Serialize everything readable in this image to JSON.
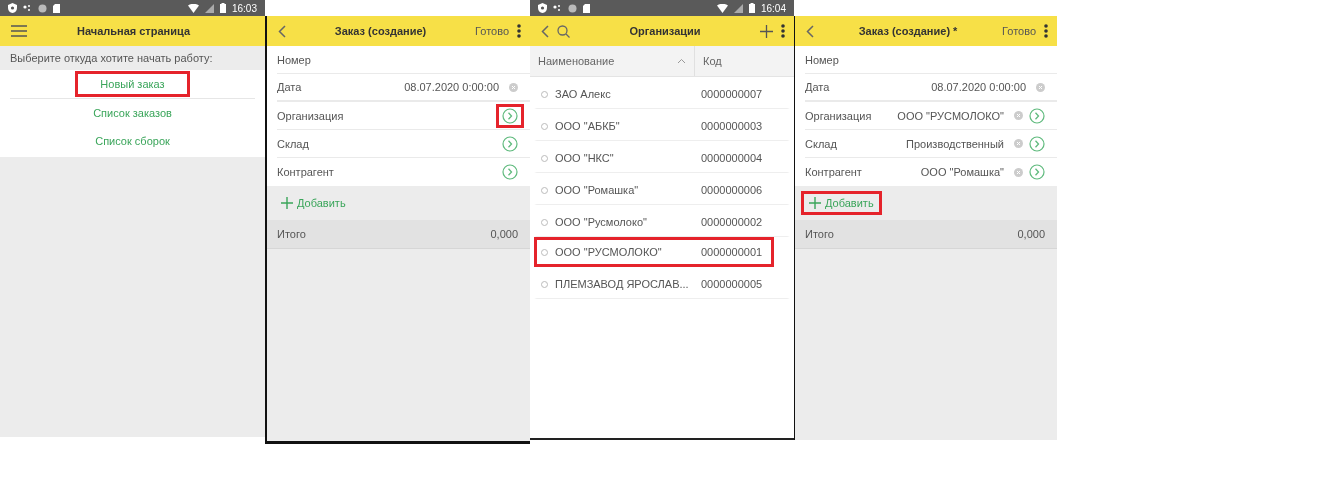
{
  "screens": [
    {
      "kind": "start",
      "status_bar": {
        "time": "16:03"
      },
      "title": "Начальная страница",
      "prompt": "Выберите откуда хотите начать работу:",
      "actions": [
        {
          "label": "Новый заказ",
          "highlighted": true
        },
        {
          "label": "Список заказов",
          "highlighted": false
        },
        {
          "label": "Список сборок",
          "highlighted": false
        }
      ]
    },
    {
      "kind": "form",
      "title": "Заказ (создание)",
      "done": "Готово",
      "fields": [
        {
          "label": "Номер",
          "clearable": false,
          "select": false
        },
        {
          "label": "Дата",
          "value": "08.07.2020  0:00:00",
          "clearable": true,
          "select": false
        },
        {
          "label": "Организация",
          "clearable": false,
          "select": true,
          "highlighted": true
        },
        {
          "label": "Склад",
          "clearable": false,
          "select": true,
          "highlighted": false
        },
        {
          "label": "Контрагент",
          "clearable": false,
          "select": true,
          "highlighted": false
        }
      ],
      "add": {
        "label": "Добавить",
        "highlighted": false
      },
      "total_label": "Итого",
      "total": "0,000"
    },
    {
      "kind": "list",
      "status_bar": {
        "time": "16:04"
      },
      "title": "Организации",
      "columns": [
        "Наименование",
        "Код"
      ],
      "rows": [
        {
          "name": "ЗАО Алекс",
          "code": "0000000007",
          "highlighted": false
        },
        {
          "name": "ООО \"АБКБ\"",
          "code": "0000000003",
          "highlighted": false
        },
        {
          "name": "ООО \"НКС\"",
          "code": "0000000004",
          "highlighted": false
        },
        {
          "name": "ООО \"Ромашка\"",
          "code": "0000000006",
          "highlighted": false
        },
        {
          "name": "ООО \"Русмолоко\"",
          "code": "0000000002",
          "highlighted": false
        },
        {
          "name": "ООО \"РУСМОЛОКО\"",
          "code": "0000000001",
          "highlighted": true
        },
        {
          "name": "ПЛЕМЗАВОД ЯРОСЛАВ...",
          "code": "0000000005",
          "highlighted": false
        }
      ]
    },
    {
      "kind": "form",
      "title": "Заказ (создание) *",
      "done": "Готово",
      "fields": [
        {
          "label": "Номер",
          "clearable": false,
          "select": false
        },
        {
          "label": "Дата",
          "value": "08.07.2020  0:00:00",
          "clearable": true,
          "select": false
        },
        {
          "label": "Организация",
          "value": "ООО \"РУСМОЛОКО\"",
          "clearable": true,
          "select": true,
          "highlighted": false
        },
        {
          "label": "Склад",
          "value": "Производственный",
          "clearable": true,
          "select": true,
          "highlighted": false
        },
        {
          "label": "Контрагент",
          "value": "ООО \"Ромашка\"",
          "clearable": true,
          "select": true,
          "highlighted": false
        }
      ],
      "add": {
        "label": "Добавить",
        "highlighted": true
      },
      "total_label": "Итого",
      "total": "0,000"
    }
  ]
}
